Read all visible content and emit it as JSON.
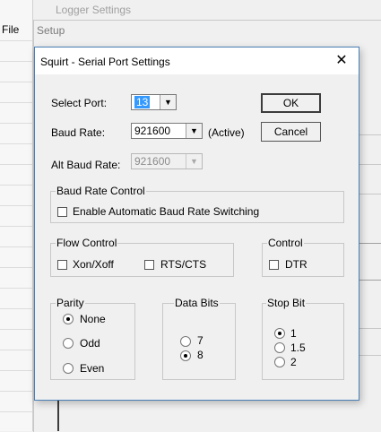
{
  "background": {
    "menu_file": "File",
    "logger_title": "Logger Settings",
    "setup_title": "Setup"
  },
  "dialog": {
    "title": "Squirt - Serial Port Settings",
    "close_glyph": "✕",
    "select_port": {
      "label": "Select Port:",
      "value": "13"
    },
    "baud_rate": {
      "label": "Baud Rate:",
      "value": "921600",
      "status": "(Active)"
    },
    "alt_baud_rate": {
      "label": "Alt Baud Rate:",
      "value": "921600"
    },
    "ok_label": "OK",
    "cancel_label": "Cancel",
    "baud_rate_control": {
      "legend": "Baud Rate Control",
      "auto_switch_label": "Enable Automatic Baud Rate Switching",
      "auto_switch_checked": false
    },
    "flow_control": {
      "legend": "Flow Control",
      "xon_xoff_label": "Xon/Xoff",
      "xon_xoff_checked": false,
      "rts_cts_label": "RTS/CTS",
      "rts_cts_checked": false
    },
    "control": {
      "legend": "Control",
      "dtr_label": "DTR",
      "dtr_checked": false
    },
    "parity": {
      "legend": "Parity",
      "options": [
        "None",
        "Odd",
        "Even"
      ],
      "selected": "None"
    },
    "data_bits": {
      "legend": "Data Bits",
      "options": [
        "7",
        "8"
      ],
      "selected": "8"
    },
    "stop_bit": {
      "legend": "Stop Bit",
      "options": [
        "1",
        "1.5",
        "2"
      ],
      "selected": "1"
    }
  }
}
